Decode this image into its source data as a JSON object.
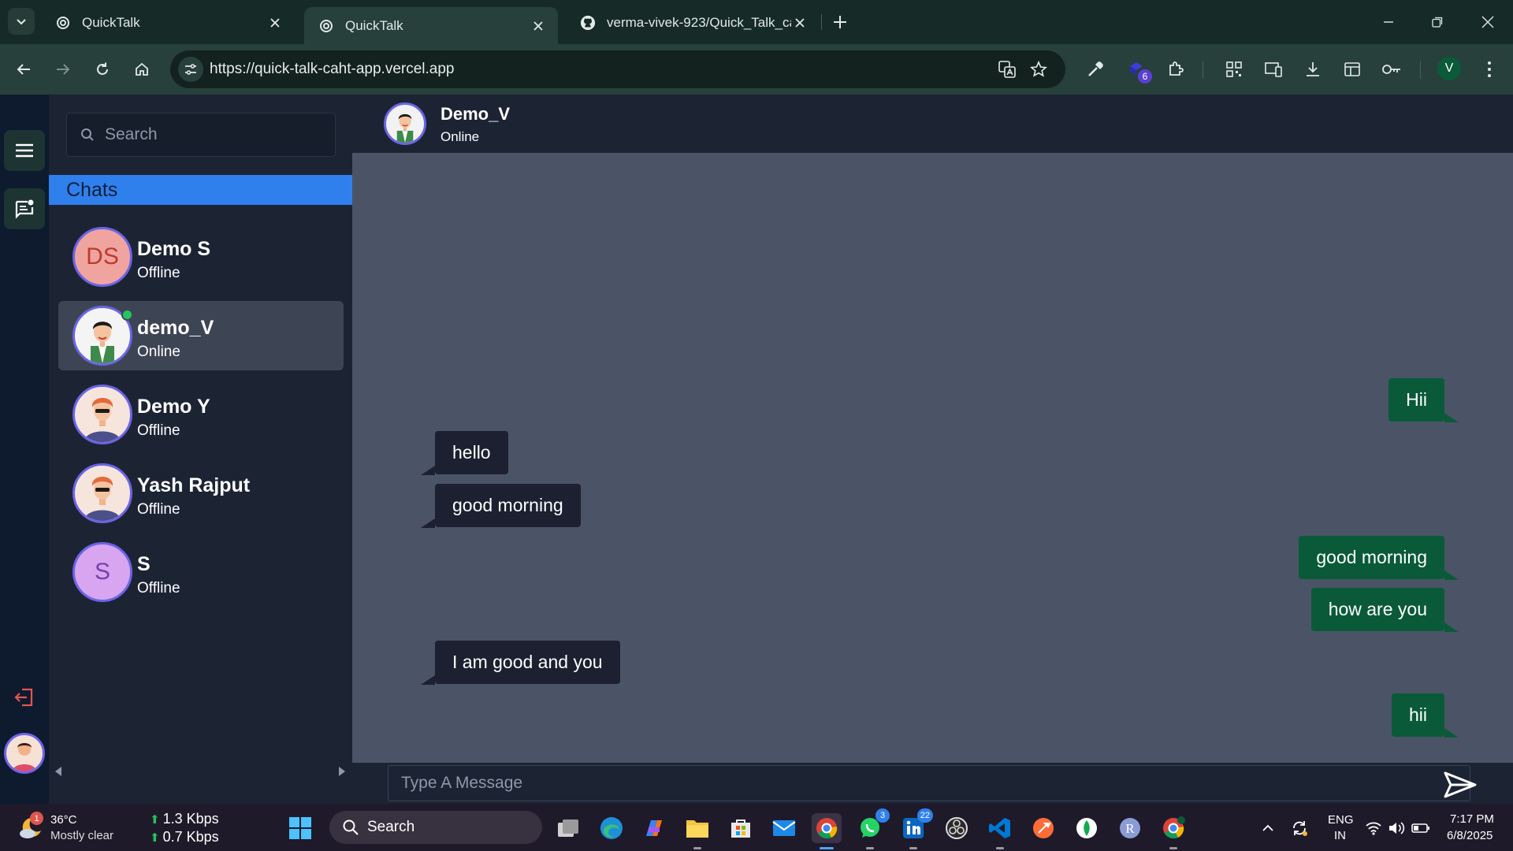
{
  "browser": {
    "tabs": [
      {
        "title": "QuickTalk"
      },
      {
        "title": "QuickTalk"
      },
      {
        "title": "verma-vivek-923/Quick_Talk_ca"
      }
    ],
    "url": "https://quick-talk-caht-app.vercel.app",
    "extension_badge": "6",
    "profile_initial": "V"
  },
  "app": {
    "search_placeholder": "Search",
    "chats_heading": "Chats",
    "contacts": [
      {
        "name": "Demo S",
        "status": "Offline",
        "initials": "DS",
        "avatar_color": "#f0a4a0",
        "initials_color": "#c0392b"
      },
      {
        "name": "demo_V",
        "status": "Online"
      },
      {
        "name": "Demo Y",
        "status": "Offline"
      },
      {
        "name": "Yash Rajput",
        "status": "Offline"
      },
      {
        "name": "S",
        "status": "Offline",
        "initials": "S",
        "avatar_color": "#d8a6f0",
        "initials_color": "#7b3fa8"
      }
    ],
    "conversation": {
      "name": "Demo_V",
      "status": "Online",
      "messages": [
        {
          "text": "Hii",
          "direction": "out"
        },
        {
          "text": "hello",
          "direction": "in"
        },
        {
          "text": "good morning",
          "direction": "in"
        },
        {
          "text": "good morning",
          "direction": "out"
        },
        {
          "text": "how are you",
          "direction": "out"
        },
        {
          "text": "I am good and you",
          "direction": "in"
        },
        {
          "text": "hii",
          "direction": "out"
        }
      ]
    },
    "composer_placeholder": "Type A Message",
    "colors": {
      "accent": "#2f80ed",
      "outgoing": "#0a5a3a",
      "incoming": "#1c2030",
      "online": "#22c55e"
    }
  },
  "taskbar": {
    "weather_temp": "36°C",
    "weather_desc": "Mostly clear",
    "weather_badge": "1",
    "net_up": "1.3 Kbps",
    "net_down": "0.7 Kbps",
    "search_label": "Search",
    "whatsapp_badge": "3",
    "linkedin_badge": "22",
    "lang_line1": "ENG",
    "lang_line2": "IN",
    "time": "7:17 PM",
    "date": "6/8/2025"
  }
}
